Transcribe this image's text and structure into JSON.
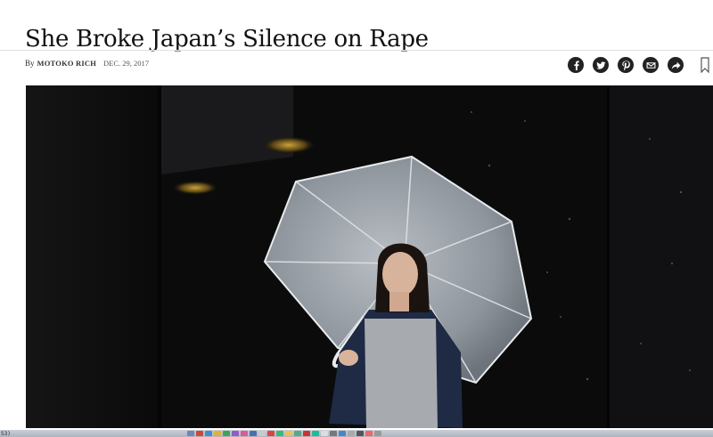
{
  "article": {
    "headline": "She Broke Japan’s Silence on Rape",
    "byline_prefix": "By",
    "author": "MOTOKO RICH",
    "date": "DEC. 29, 2017"
  },
  "share": {
    "buttons": [
      {
        "icon": "facebook-icon"
      },
      {
        "icon": "twitter-icon"
      },
      {
        "icon": "pinterest-icon"
      },
      {
        "icon": "email-icon"
      },
      {
        "icon": "share-arrow-icon"
      }
    ],
    "bookmark_icon": "bookmark-icon"
  },
  "photo": {
    "icon": "lead-photo"
  },
  "taskbar": {
    "clock_text": "53)",
    "app_colors": [
      "#6f86b8",
      "#c94a3a",
      "#3d8fd1",
      "#e0b13a",
      "#3aa55d",
      "#8c5fc7",
      "#d85b9a",
      "#4a6fb0",
      "#c9c9c9",
      "#d44",
      "#3b7",
      "#eac14d",
      "#5a8",
      "#c33",
      "#2b9",
      "#ddd",
      "#777",
      "#48c",
      "#aaa",
      "#555",
      "#e66",
      "#999"
    ]
  },
  "colors": {
    "text": "#111111",
    "share_button_bg": "#222222",
    "photo_background": "#0d0d0e"
  }
}
